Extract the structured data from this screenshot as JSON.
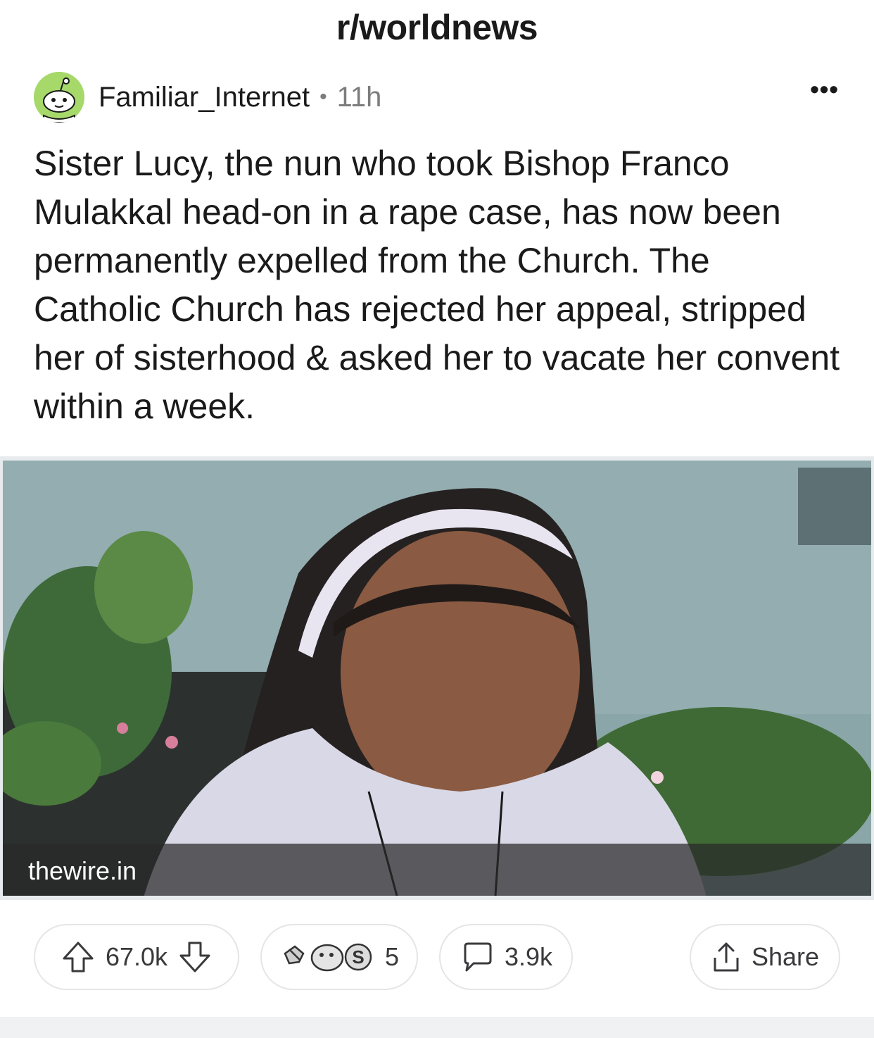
{
  "header": {
    "subreddit": "r/worldnews"
  },
  "post": {
    "username": "Familiar_Internet",
    "separator": "•",
    "age": "11h",
    "more_menu": "•••",
    "title": "Sister Lucy, the nun who took Bishop Franco Mulakkal head-on in a rape case, has now been permanently expelled from the Church. The Catholic Church has rejected her appeal, stripped her of sisterhood & asked her to vacate her convent within a week.",
    "media": {
      "domain": "thewire.in",
      "image_icon": "photo-nun-portrait"
    }
  },
  "actions": {
    "score": "67.0k",
    "awards_count": "5",
    "comments_count": "3.9k",
    "share_label": "Share"
  },
  "colors": {
    "avatar_bg": "#a6d96a",
    "text": "#1a1a1b",
    "muted": "#7c7c7c",
    "pill_border": "#e5e5e5"
  }
}
